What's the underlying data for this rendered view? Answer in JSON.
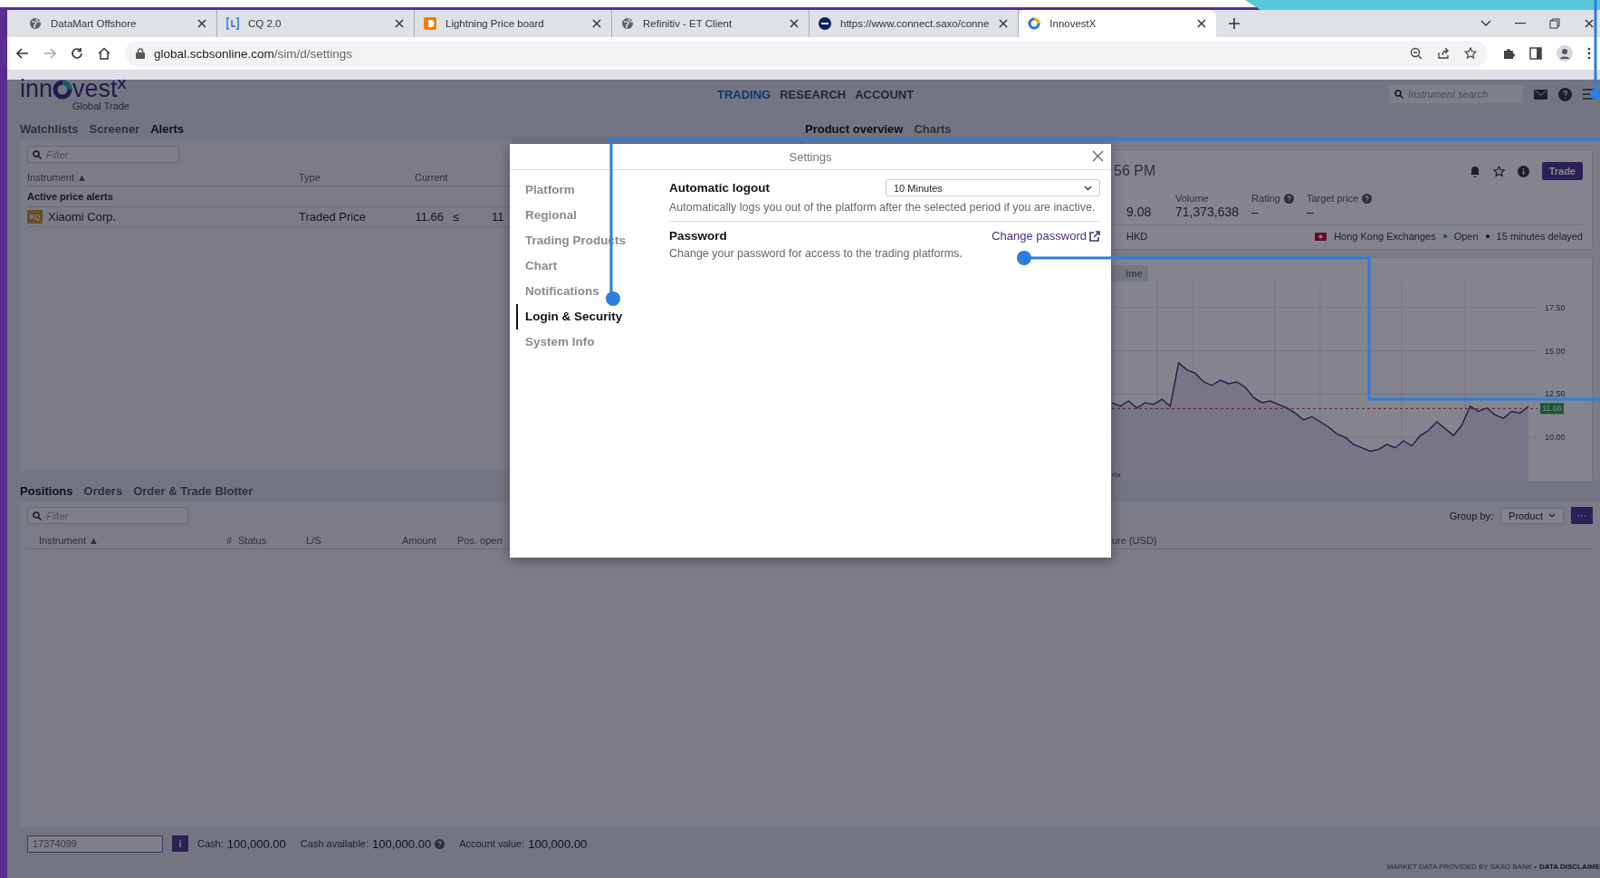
{
  "browser": {
    "tabs": [
      {
        "title": "DataMart Offshore",
        "selected": false
      },
      {
        "title": "CQ 2.0",
        "selected": false
      },
      {
        "title": "Lightning Price board",
        "selected": false
      },
      {
        "title": "Refinitiv - ET Client",
        "selected": false
      },
      {
        "title": "https://www.connect.saxo/conne",
        "selected": false
      },
      {
        "title": "InnovestX",
        "selected": true
      }
    ],
    "url": {
      "host": "global.scbsonline.com",
      "path": "/sim/d/settings"
    }
  },
  "app": {
    "logo": {
      "name": "inn",
      "name_end": "vest",
      "mark": "X",
      "tagline": "Global Trade"
    },
    "nav": [
      {
        "label": "TRADING",
        "selected": true
      },
      {
        "label": "RESEARCH",
        "selected": false
      },
      {
        "label": "ACCOUNT",
        "selected": false
      }
    ],
    "search": {
      "placeholder": "Instrument search"
    }
  },
  "alerts_panel": {
    "tabs": [
      {
        "label": "Watchlists",
        "selected": false
      },
      {
        "label": "Screener",
        "selected": false
      },
      {
        "label": "Alerts",
        "selected": true
      }
    ],
    "filter": {
      "placeholder": "Filter"
    },
    "columns": [
      "Instrument ▲",
      "Type",
      "Current"
    ],
    "group": "Active price alerts",
    "rows": [
      {
        "badge": "EQ",
        "instrument": "Xiaomi Corp.",
        "type": "Traded Price",
        "current": "11.66",
        "operator": "≤",
        "column_4": "11"
      }
    ]
  },
  "product_panel": {
    "tabs": [
      {
        "label": "Product overview",
        "selected": true
      },
      {
        "label": "Charts",
        "selected": false
      }
    ],
    "time": "56 PM",
    "trade_button": "Trade",
    "stats": [
      {
        "value": "9.08",
        "help": false
      },
      {
        "label": "Volume",
        "value": "71,373,638",
        "help": false
      },
      {
        "label": "Rating",
        "value": "–",
        "help": true
      },
      {
        "label": "Target price",
        "value": "–",
        "help": true
      }
    ],
    "currency": "HKD",
    "exchange": "Hong Kong Exchanges",
    "market_state": "Open",
    "delay": "15 minutes delayed",
    "range_button": "ime",
    "chart_corner": "rta",
    "chart_data": {
      "type": "line",
      "ylim": [
        7.5,
        19
      ],
      "grid": true,
      "yticks": [
        {
          "value": 10,
          "label": "10.00"
        },
        {
          "value": 12.5,
          "label": "12.50"
        },
        {
          "value": 15,
          "label": "15.00"
        },
        {
          "value": 17.5,
          "label": "17.50"
        }
      ],
      "ref_lines": [
        {
          "axis": "y",
          "value": 11.66,
          "label": "11.66"
        }
      ],
      "series": [
        {
          "color": "#3b2f6e",
          "values": [
            12.0,
            11.8,
            12.1,
            11.7,
            12.0,
            11.9,
            12.2,
            11.8,
            14.3,
            13.9,
            13.7,
            13.2,
            13.0,
            13.3,
            13.1,
            13.2,
            12.9,
            12.3,
            12.0,
            12.1,
            11.9,
            11.7,
            11.4,
            11.0,
            11.2,
            10.9,
            10.6,
            10.2,
            10.0,
            9.6,
            9.4,
            9.2,
            9.3,
            9.6,
            9.4,
            9.8,
            9.5,
            10.1,
            10.4,
            10.9,
            10.5,
            10.1,
            10.7,
            11.8,
            11.5,
            11.7,
            11.3,
            11.1,
            11.5,
            11.4,
            11.8
          ]
        }
      ]
    }
  },
  "positions_panel": {
    "tabs": [
      {
        "label": "Positions",
        "selected": true
      },
      {
        "label": "Orders",
        "selected": false
      },
      {
        "label": "Order & Trade Blotter",
        "selected": false
      }
    ],
    "filter": {
      "placeholder": "Filter"
    },
    "group_by": {
      "label": "Group by:",
      "value": "Product"
    },
    "more_button": "···",
    "columns": [
      "Instrument ▲",
      "#",
      "Status",
      "L/S",
      "Amount",
      "Pos. open",
      "ure (USD)"
    ]
  },
  "status_bar": {
    "account": "17374099",
    "info_button": "i",
    "figures": [
      {
        "label": "Cash:",
        "value": "100,000.00",
        "help": false
      },
      {
        "label": "Cash available:",
        "value": "100,000.00",
        "help": true
      },
      {
        "label": "Account value:",
        "value": "100,000.00",
        "help": false
      }
    ]
  },
  "footer": {
    "text": "MARKET DATA PROVIDED BY SAXO BANK •",
    "link": "DATA DISCLAIME"
  },
  "settings_dialog": {
    "title": "Settings",
    "nav": [
      {
        "label": "Platform",
        "selected": false
      },
      {
        "label": "Regional",
        "selected": false
      },
      {
        "label": "Trading Products",
        "selected": false
      },
      {
        "label": "Chart",
        "selected": false
      },
      {
        "label": "Notifications",
        "selected": false
      },
      {
        "label": "Login & Security",
        "selected": true
      },
      {
        "label": "System Info",
        "selected": false
      }
    ],
    "sections": [
      {
        "kind": "select",
        "title": "Automatic logout",
        "value": "10 Minutes",
        "description": "Automatically logs you out of the platform after the selected period if you are inactive."
      },
      {
        "kind": "link",
        "title": "Password",
        "link": "Change password",
        "description": "Change your password for access to the trading platforms."
      }
    ]
  }
}
